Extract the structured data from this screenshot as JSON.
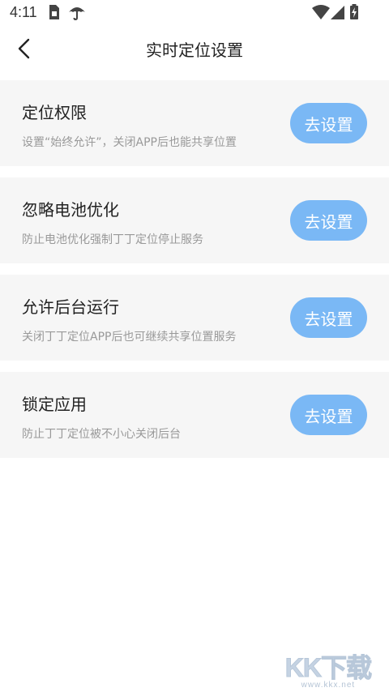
{
  "status_bar": {
    "time": "4:11",
    "icons": [
      "sim-card-icon",
      "umbrella-icon",
      "wifi-icon",
      "cellular-signal-icon",
      "battery-charging-icon"
    ]
  },
  "header": {
    "title": "实时定位设置",
    "back_icon": "chevron-left-icon"
  },
  "settings": [
    {
      "title": "定位权限",
      "description": "设置“始终允许”，关闭APP后也能共享位置",
      "button_label": "去设置"
    },
    {
      "title": "忽略电池优化",
      "description": "防止电池优化强制丁丁定位停止服务",
      "button_label": "去设置"
    },
    {
      "title": "允许后台运行",
      "description": "关闭丁丁定位APP后也可继续共享位置服务",
      "button_label": "去设置"
    },
    {
      "title": "锁定应用",
      "description": "防止丁丁定位被不小心关闭后台",
      "button_label": "去设置"
    }
  ],
  "colors": {
    "accent": "#7ab8f5",
    "card_background": "#f6f6f6",
    "title_text": "#222222",
    "description_text": "#999999"
  },
  "watermark": {
    "logo": "KK下载",
    "url": "www.kkx.net"
  }
}
